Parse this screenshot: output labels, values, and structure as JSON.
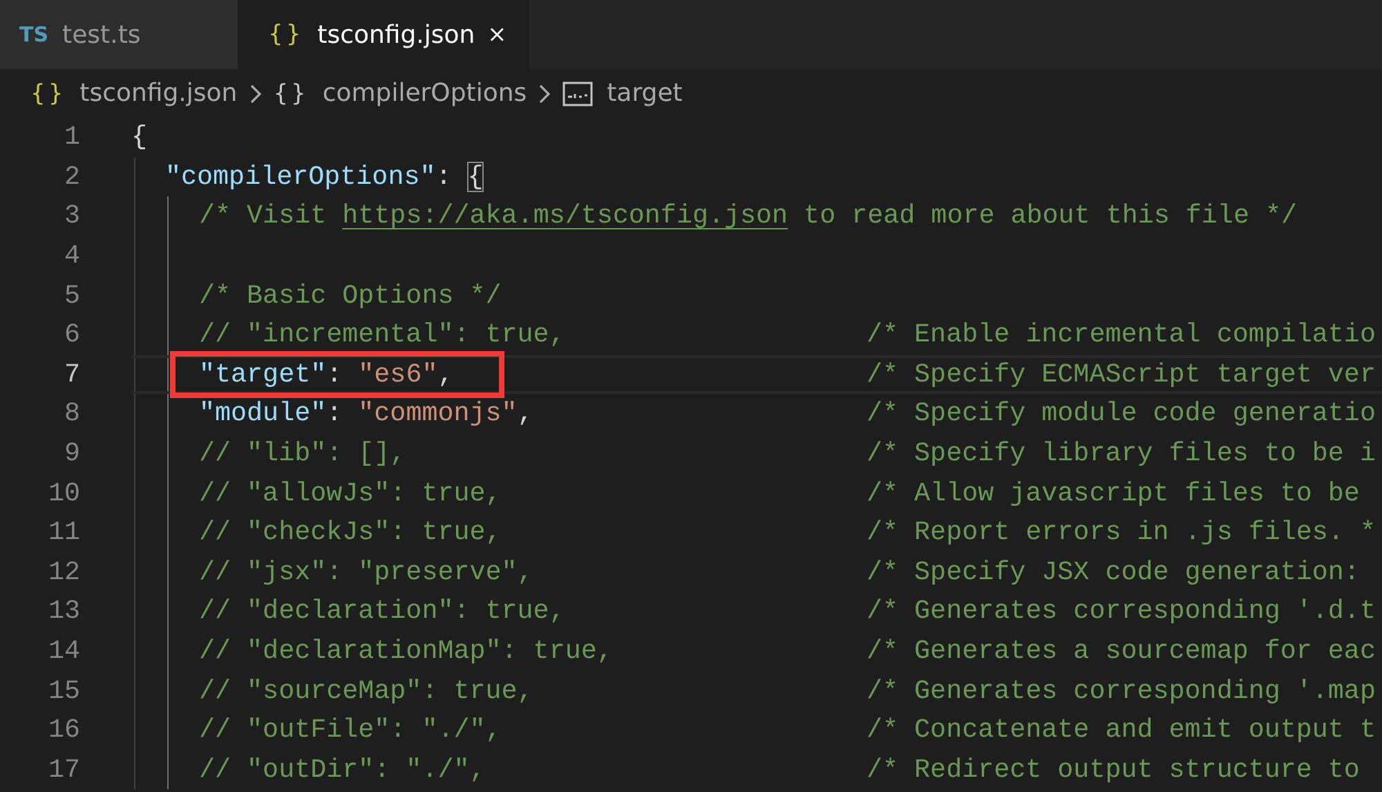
{
  "tabs": [
    {
      "badge": "TS",
      "kind": "ts",
      "label": "test.ts",
      "selected": false,
      "closable": false
    },
    {
      "badge": "{}",
      "kind": "json",
      "label": "tsconfig.json",
      "selected": true,
      "closable": true
    }
  ],
  "breadcrumb": [
    {
      "badge": "{}",
      "kind": "json",
      "label": "tsconfig.json"
    },
    {
      "badge": "{}",
      "kind": "object",
      "label": "compilerOptions"
    },
    {
      "kind": "string",
      "label": "target"
    }
  ],
  "editor": {
    "lines": [
      {
        "number": "1",
        "current": false,
        "annotated": false,
        "tokens": [
          {
            "kind": "punct",
            "text": "{"
          }
        ],
        "children": [
          {
            "number": "2",
            "current": false,
            "annotated": false,
            "tokens": [
              {
                "kind": "key",
                "text": "\"compilerOptions\""
              },
              {
                "kind": "punct",
                "text": ": "
              },
              {
                "kind": "bracket-match",
                "text": "{"
              }
            ],
            "children": [
              {
                "number": "3",
                "current": false,
                "annotated": false,
                "tokens": [
                  {
                    "kind": "comment",
                    "text": "/* Visit "
                  },
                  {
                    "kind": "link",
                    "text": "https://aka.ms/tsconfig.json"
                  },
                  {
                    "kind": "comment",
                    "text": " to read more about this file */"
                  }
                ]
              },
              {
                "number": "4",
                "current": false,
                "annotated": false
              },
              {
                "number": "5",
                "current": false,
                "annotated": false,
                "tokens": [
                  {
                    "kind": "comment",
                    "text": "/* Basic Options */"
                  }
                ]
              },
              {
                "number": "6",
                "current": false,
                "annotated": false,
                "tokens": [
                  {
                    "kind": "comment",
                    "text": "// \"incremental\": true,"
                  }
                ],
                "note": "/* Enable incremental compilatio"
              },
              {
                "number": "7",
                "current": true,
                "annotated": true,
                "tokens": [
                  {
                    "kind": "key",
                    "text": "\"target\""
                  },
                  {
                    "kind": "punct",
                    "text": ": "
                  },
                  {
                    "kind": "string",
                    "text": "\"es6\""
                  },
                  {
                    "kind": "punct",
                    "text": ","
                  }
                ],
                "note": "/* Specify ECMAScript target ver"
              },
              {
                "number": "8",
                "current": false,
                "annotated": false,
                "tokens": [
                  {
                    "kind": "key",
                    "text": "\"module\""
                  },
                  {
                    "kind": "punct",
                    "text": ": "
                  },
                  {
                    "kind": "string",
                    "text": "\"commonjs\""
                  },
                  {
                    "kind": "punct",
                    "text": ","
                  }
                ],
                "note": "/* Specify module code generatio"
              },
              {
                "number": "9",
                "current": false,
                "annotated": false,
                "tokens": [
                  {
                    "kind": "comment",
                    "text": "// \"lib\": [],"
                  }
                ],
                "note": "/* Specify library files to be i"
              },
              {
                "number": "10",
                "current": false,
                "annotated": false,
                "tokens": [
                  {
                    "kind": "comment",
                    "text": "// \"allowJs\": true,"
                  }
                ],
                "note": "/* Allow javascript files to be"
              },
              {
                "number": "11",
                "current": false,
                "annotated": false,
                "tokens": [
                  {
                    "kind": "comment",
                    "text": "// \"checkJs\": true,"
                  }
                ],
                "note": "/* Report errors in .js files. *"
              },
              {
                "number": "12",
                "current": false,
                "annotated": false,
                "tokens": [
                  {
                    "kind": "comment",
                    "text": "// \"jsx\": \"preserve\","
                  }
                ],
                "note": "/* Specify JSX code generation:"
              },
              {
                "number": "13",
                "current": false,
                "annotated": false,
                "tokens": [
                  {
                    "kind": "comment",
                    "text": "// \"declaration\": true,"
                  }
                ],
                "note": "/* Generates corresponding '.d.t"
              },
              {
                "number": "14",
                "current": false,
                "annotated": false,
                "tokens": [
                  {
                    "kind": "comment",
                    "text": "// \"declarationMap\": true,"
                  }
                ],
                "note": "/* Generates a sourcemap for eac"
              },
              {
                "number": "15",
                "current": false,
                "annotated": false,
                "tokens": [
                  {
                    "kind": "comment",
                    "text": "// \"sourceMap\": true,"
                  }
                ],
                "note": "/* Generates corresponding '.map"
              },
              {
                "number": "16",
                "current": false,
                "annotated": false,
                "tokens": [
                  {
                    "kind": "comment",
                    "text": "// \"outFile\": \"./\","
                  }
                ],
                "note": "/* Concatenate and emit output t"
              },
              {
                "number": "17",
                "current": false,
                "annotated": false,
                "tokens": [
                  {
                    "kind": "comment",
                    "text": "// \"outDir\": \"./\","
                  }
                ],
                "note": "/* Redirect output structure to"
              }
            ]
          }
        ]
      }
    ]
  }
}
